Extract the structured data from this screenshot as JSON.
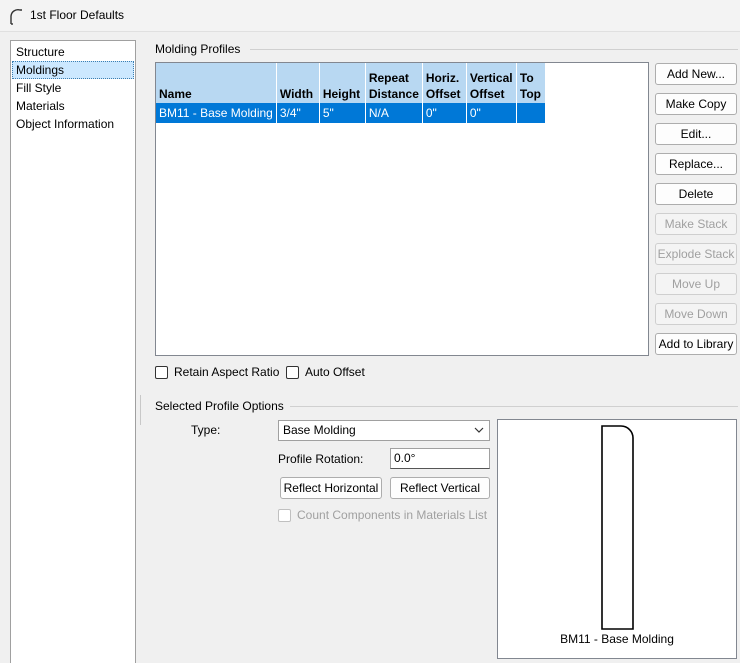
{
  "window": {
    "title": "1st Floor Defaults",
    "icon": "molding-arc-icon"
  },
  "nav": {
    "items": [
      {
        "label": "Structure",
        "selected": false
      },
      {
        "label": "Moldings",
        "selected": true
      },
      {
        "label": "Fill Style",
        "selected": false
      },
      {
        "label": "Materials",
        "selected": false
      },
      {
        "label": "Object Information",
        "selected": false
      }
    ]
  },
  "molding_profiles": {
    "group_label": "Molding Profiles",
    "columns": [
      {
        "line1": "",
        "line2": "Name"
      },
      {
        "line1": "",
        "line2": "Width"
      },
      {
        "line1": "",
        "line2": "Height"
      },
      {
        "line1": "Repeat",
        "line2": "Distance"
      },
      {
        "line1": "Horiz.",
        "line2": "Offset"
      },
      {
        "line1": "Vertical",
        "line2": "Offset"
      },
      {
        "line1": "To",
        "line2": "Top"
      }
    ],
    "rows": [
      {
        "cells": [
          "BM11 - Base Molding",
          "3/4\"",
          "5\"",
          "N/A",
          "0\"",
          "0\"",
          ""
        ],
        "selected": true
      }
    ]
  },
  "buttons": {
    "add_new": "Add New...",
    "make_copy": "Make Copy",
    "edit": "Edit...",
    "replace": "Replace...",
    "delete": "Delete",
    "make_stack": "Make Stack",
    "explode_stack": "Explode Stack",
    "move_up": "Move Up",
    "move_down": "Move Down",
    "add_to_library": "Add to Library"
  },
  "options": {
    "retain_aspect_ratio": {
      "label": "Retain Aspect Ratio",
      "checked": false
    },
    "auto_offset": {
      "label": "Auto Offset",
      "checked": false
    }
  },
  "selected_profile": {
    "group_label": "Selected Profile Options",
    "type_label": "Type:",
    "type_value": "Base Molding",
    "rotation_label": "Profile Rotation:",
    "rotation_value": "0.0°",
    "reflect_horizontal": "Reflect Horizontal",
    "reflect_vertical": "Reflect Vertical",
    "count_components": {
      "label": "Count Components in Materials List",
      "checked": false,
      "enabled": false
    },
    "preview_caption": "BM11 - Base Molding"
  },
  "colors": {
    "selection": "#0078d7",
    "header": "#b8d8f2",
    "nav_selection": "#cce8ff"
  }
}
